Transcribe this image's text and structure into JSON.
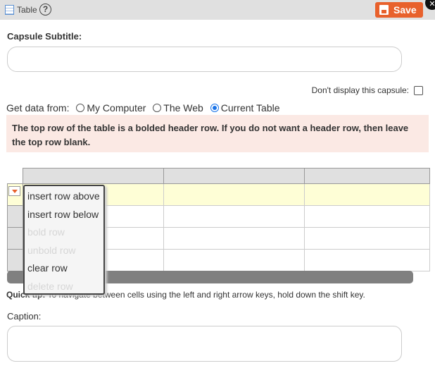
{
  "header": {
    "title": "Table",
    "help_icon": "question-circle-icon",
    "save_label": "Save",
    "accent": "#e8612c"
  },
  "subtitle": {
    "label": "Capsule Subtitle:",
    "value": ""
  },
  "hide_capsule": {
    "label": "Don't display this capsule:",
    "checked": false
  },
  "source": {
    "label": "Get data from:",
    "options": [
      "My Computer",
      "The Web",
      "Current Table"
    ],
    "selected": "Current Table"
  },
  "notice": "The top row of the table is a bolded header row. If you do not want a header row, then leave the top row blank.",
  "row_menu": {
    "items": [
      {
        "label": "insert row above",
        "enabled": true
      },
      {
        "label": "insert row below",
        "enabled": true
      },
      {
        "label": "bold row",
        "enabled": false
      },
      {
        "label": "unbold row",
        "enabled": false
      },
      {
        "label": "clear row",
        "enabled": true
      },
      {
        "label": "delete row",
        "enabled": false
      }
    ]
  },
  "tip": {
    "bold": "Quick tip:",
    "text": " To navigate between cells using the left and right arrow keys, hold down the shift key."
  },
  "caption": {
    "label": "Caption:",
    "value": ""
  }
}
